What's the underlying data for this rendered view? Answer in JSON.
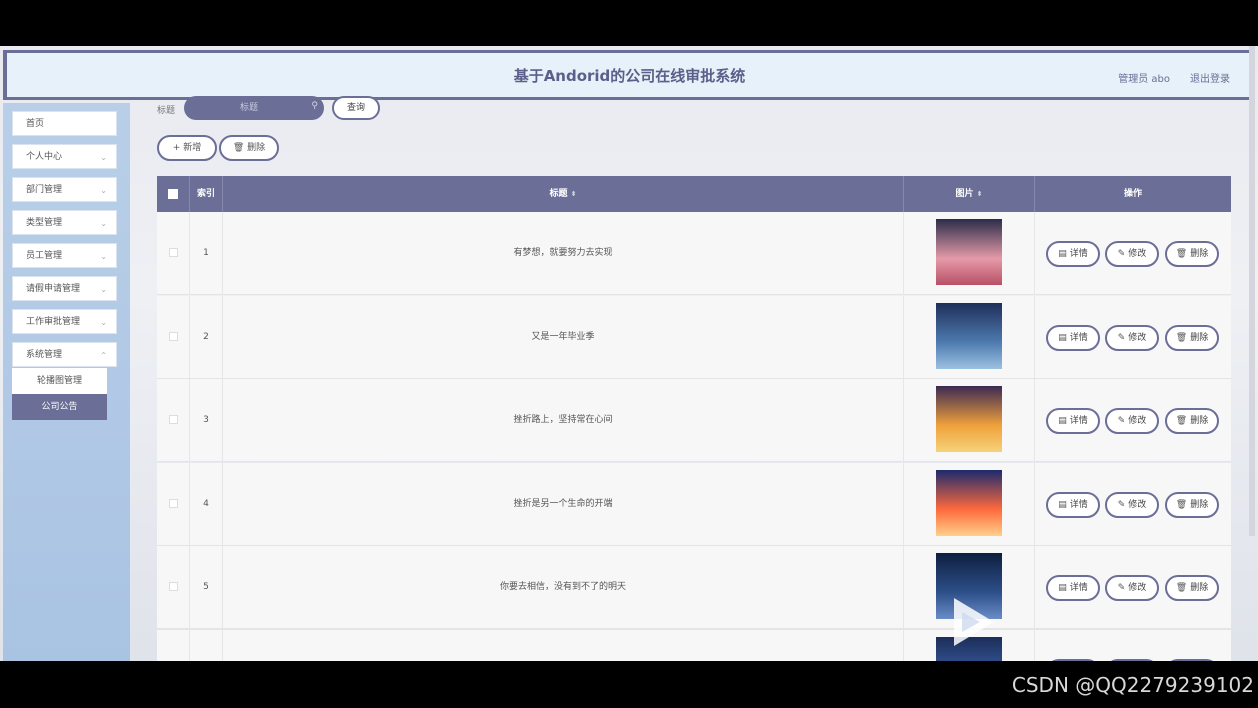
{
  "header": {
    "title": "基于Andorid的公司在线审批系统",
    "user": "管理员 abo",
    "logout": "退出登录"
  },
  "sidebar": {
    "items": [
      {
        "label": "首页",
        "has_chevron": false
      },
      {
        "label": "个人中心",
        "has_chevron": true
      },
      {
        "label": "部门管理",
        "has_chevron": true
      },
      {
        "label": "类型管理",
        "has_chevron": true
      },
      {
        "label": "员工管理",
        "has_chevron": true
      },
      {
        "label": "请假申请管理",
        "has_chevron": true
      },
      {
        "label": "工作审批管理",
        "has_chevron": true
      },
      {
        "label": "系统管理",
        "has_chevron": true
      }
    ],
    "submenu": [
      {
        "label": "轮播图管理",
        "active": false
      },
      {
        "label": "公司公告",
        "active": true
      }
    ]
  },
  "search": {
    "label": "标题",
    "placeholder": "标题",
    "query_button": "查询"
  },
  "toolbar": {
    "add_label": "新增",
    "delete_label": "删除"
  },
  "table": {
    "columns": [
      "索引",
      "标题",
      "图片",
      "操作"
    ],
    "rows": [
      {
        "index": "1",
        "title": "有梦想，就要努力去实现"
      },
      {
        "index": "2",
        "title": "又是一年毕业季"
      },
      {
        "index": "3",
        "title": "挫折路上，坚持常在心间"
      },
      {
        "index": "4",
        "title": "挫折是另一个生命的开端"
      },
      {
        "index": "5",
        "title": "你要去相信，没有到不了的明天"
      },
      {
        "index": "",
        "title": ""
      }
    ],
    "actions": {
      "detail": "详情",
      "edit": "修改",
      "delete": "删除"
    }
  },
  "watermark": "CSDN @QQ2279239102",
  "colors": {
    "accent": "#6b6e96",
    "header_bg": "#e6f1f9",
    "sidebar_bg": "#b0c8e6"
  }
}
